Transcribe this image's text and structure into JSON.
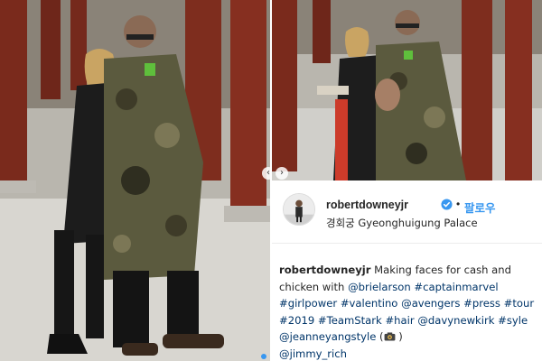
{
  "post": {
    "username": "robertdowneyjr",
    "follow_label": "팔로우",
    "separator": "•",
    "location": "경회궁 Gyeonghuigung Palace",
    "caption": {
      "user": "robertdowneyjr",
      "text_1": " Making faces for cash and chicken with ",
      "mention_1": "@brielarson",
      "tag_1": "#captainmarvel",
      "tag_2": "#girlpower",
      "tag_3": "#valentino",
      "mention_2": "@avengers",
      "tag_4": "#press",
      "tag_5": "#tour",
      "tag_6": "#2019",
      "tag_7": "#TeamStark",
      "tag_8": "#hair",
      "mention_3": "@davynewkirk",
      "tag_9": "#syle",
      "mention_4": "@jeanneyangstyle",
      "paren_open": " (",
      "mention_5": "@jimmy_rich",
      "paren_close": " )"
    }
  },
  "icons": {
    "verified": "verified-badge-icon",
    "camera": "camera-icon",
    "arrow_left": "chevron-left-icon",
    "arrow_right": "chevron-right-icon"
  },
  "colors": {
    "follow_blue": "#3897f0",
    "hashtag_navy": "#003569",
    "text": "#262626",
    "pillar_red": "#7a2a1c"
  }
}
